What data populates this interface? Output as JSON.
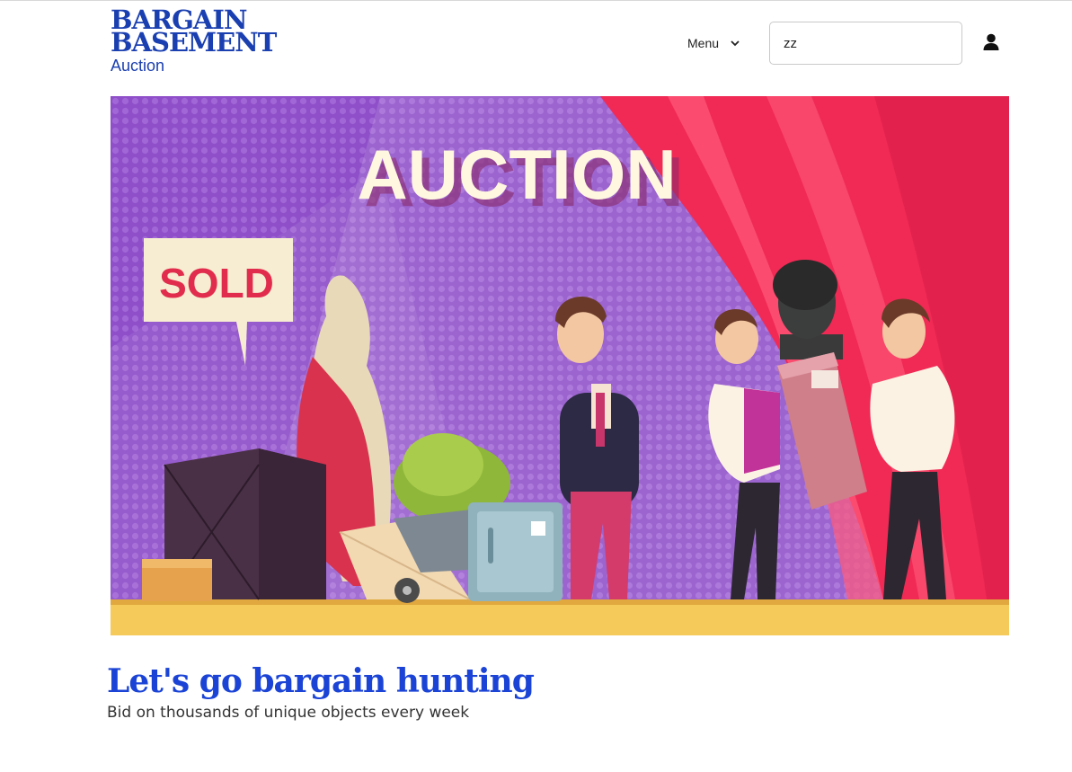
{
  "brand": {
    "line1": "BARGAIN",
    "line2": "BASEMENT",
    "line3": "Auction",
    "color": "#1a3fb0"
  },
  "nav": {
    "menu_label": "Menu",
    "search_value": "zz",
    "icons": {
      "menu": "chevron-down-icon",
      "user": "user-icon"
    }
  },
  "hero": {
    "auction_sign": "AUCTION",
    "sold_sign": "SOLD",
    "colors": {
      "wall": "#8e4fc9",
      "curtain": "#f02a55",
      "floor": "#f5c95a"
    }
  },
  "content": {
    "headline": "Let's go bargain hunting",
    "subheadline": "Bid on thousands of unique objects every week",
    "headline_color": "#1b44d6"
  }
}
